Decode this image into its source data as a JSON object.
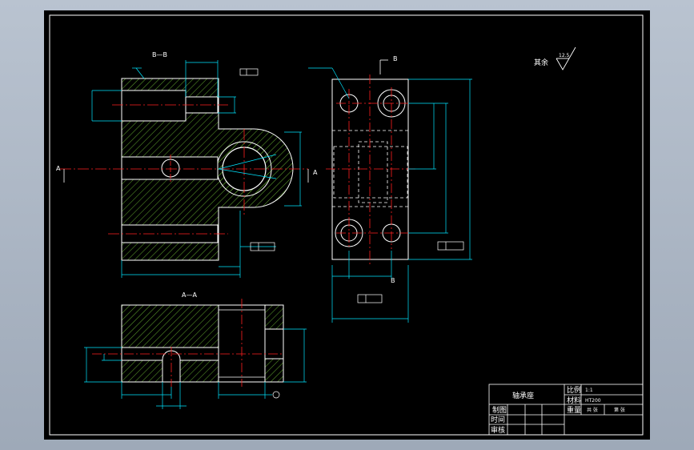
{
  "colors": {
    "background": "#000000",
    "frame": "#ffffff",
    "outline": "#ffffff",
    "hatch": "#5a9a2a",
    "dimension": "#00e5ff",
    "centerline": "#ff2020",
    "hidden": "#ffffff"
  },
  "views": {
    "section_bb": "B—B",
    "section_aa": "A—A",
    "cut_a_left": "A",
    "cut_a_right": "A",
    "cut_b_top": "B",
    "cut_b_bottom": "B"
  },
  "surface_note": {
    "label": "其余",
    "value": "12.5"
  },
  "title_block": {
    "part_name": "轴承座",
    "scale_label": "比例",
    "scale_value": "1:1",
    "material_label": "材料",
    "material_value": "HT200",
    "weight_label": "重量",
    "sheets_total": "共 张",
    "sheet_no": "第 张",
    "drawn_by_label": "制图",
    "date_label": "时间",
    "checked_by_label": "审核"
  }
}
